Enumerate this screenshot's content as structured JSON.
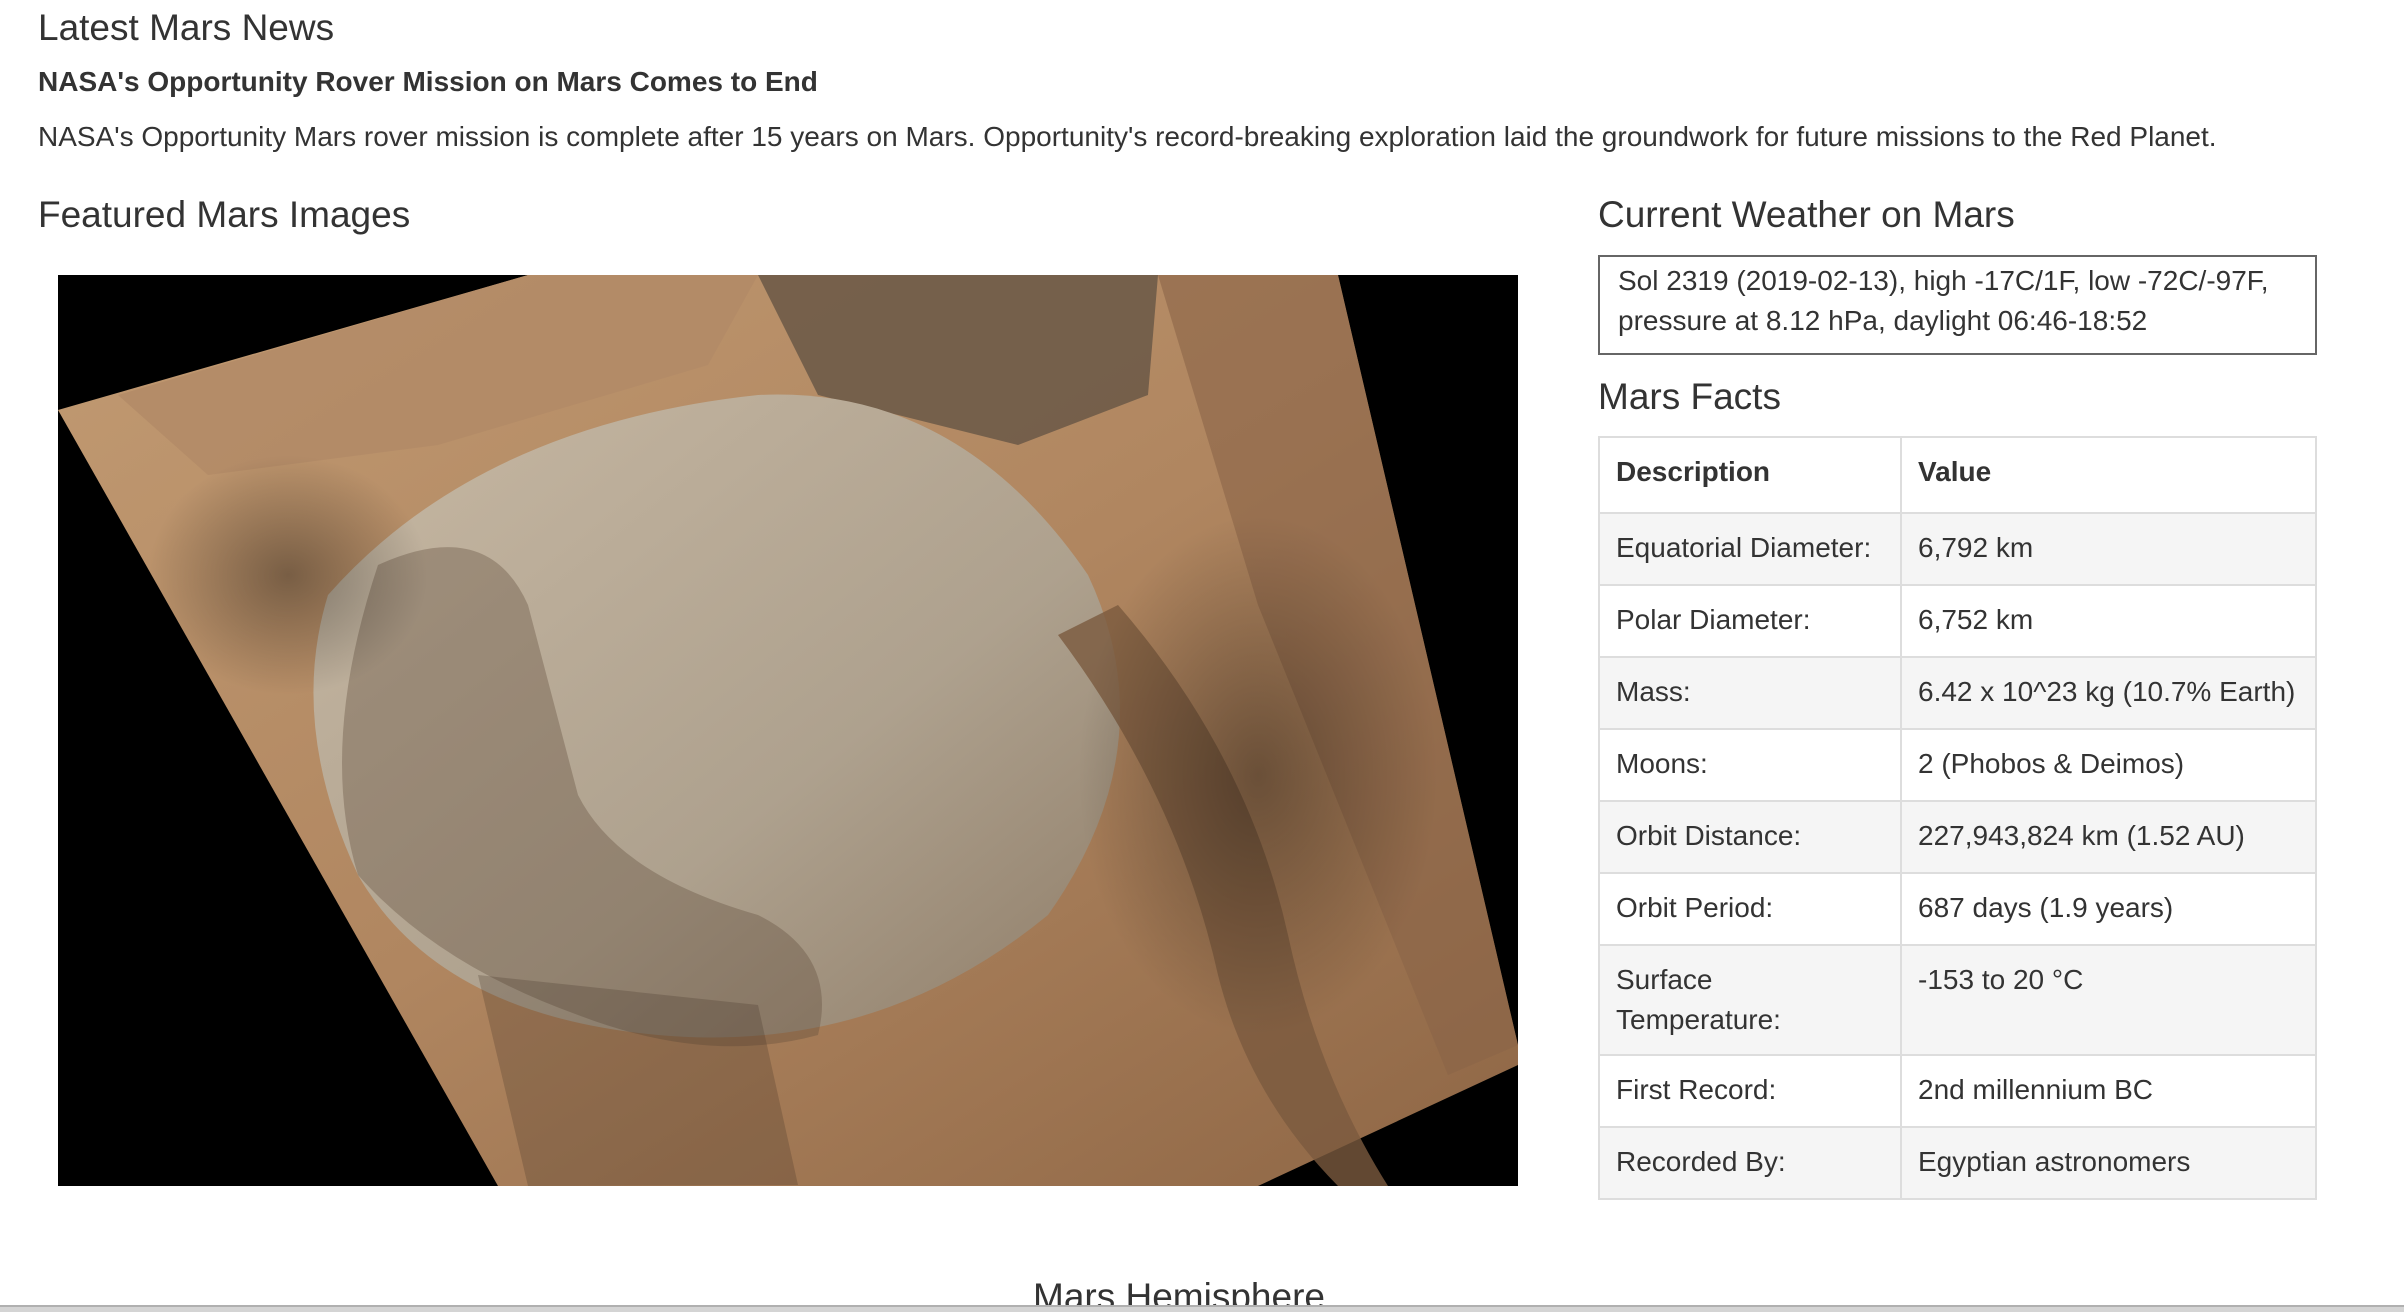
{
  "news": {
    "heading": "Latest Mars News",
    "title": "NASA's Opportunity Rover Mission on Mars Comes to End",
    "paragraph": "NASA's Opportunity Mars rover mission is complete after 15 years on Mars. Opportunity's record-breaking exploration laid the groundwork for future missions to the Red Planet."
  },
  "featured": {
    "heading": "Featured Mars Images"
  },
  "weather": {
    "heading": "Current Weather on Mars",
    "text": "Sol 2319 (2019-02-13), high -17C/1F, low -72C/-97F, pressure at 8.12 hPa, daylight 06:46-18:52"
  },
  "facts": {
    "heading": "Mars Facts",
    "columns": [
      "Description",
      "Value"
    ],
    "rows": [
      {
        "description": "Equatorial Diameter:",
        "value": "6,792 km"
      },
      {
        "description": "Polar Diameter:",
        "value": "6,752 km"
      },
      {
        "description": "Mass:",
        "value": "6.42 x 10^23 kg (10.7% Earth)"
      },
      {
        "description": "Moons:",
        "value": "2 (Phobos & Deimos)"
      },
      {
        "description": "Orbit Distance:",
        "value": "227,943,824 km (1.52 AU)"
      },
      {
        "description": "Orbit Period:",
        "value": "687 days (1.9 years)"
      },
      {
        "description": "Surface Temperature:",
        "value": "-153 to 20 °C"
      },
      {
        "description": "First Record:",
        "value": "2nd millennium BC"
      },
      {
        "description": "Recorded By:",
        "value": "Egyptian astronomers"
      }
    ]
  },
  "hemisphere": {
    "heading": "Mars Hemisphere"
  },
  "colors": {
    "text": "#333333",
    "table_border": "#dddddd",
    "table_stripe": "#f5f5f5",
    "image_background": "#000000",
    "mars_surface": "#b08660"
  }
}
